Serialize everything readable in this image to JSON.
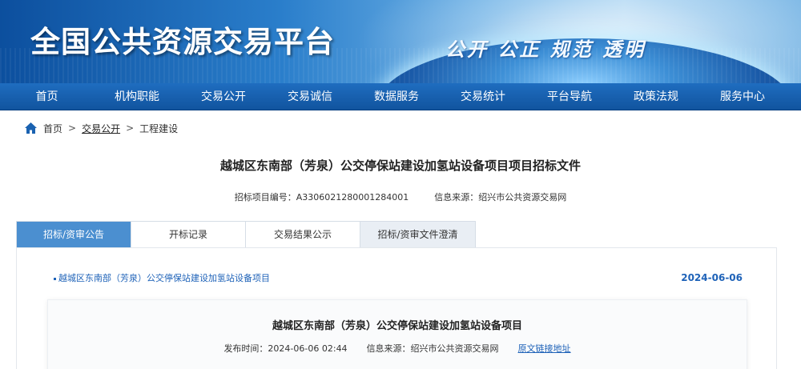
{
  "header": {
    "site_title": "全国公共资源交易平台",
    "slogan": "公开 公正 规范 透明"
  },
  "nav": {
    "items": [
      "首页",
      "机构职能",
      "交易公开",
      "交易诚信",
      "数据服务",
      "交易统计",
      "平台导航",
      "政策法规",
      "服务中心"
    ]
  },
  "breadcrumb": {
    "home": "首页",
    "separator": ">",
    "section": "交易公开",
    "current": "工程建设"
  },
  "page": {
    "title": "越城区东南部（芳泉）公交停保站建设加氢站设备项目项目招标文件",
    "project_no_label": "招标项目编号：A3306021280001284001",
    "source_label": "信息来源：绍兴市公共资源交易网"
  },
  "tabs": [
    {
      "label": "招标/资审公告",
      "active": true
    },
    {
      "label": "开标记录",
      "active": false
    },
    {
      "label": "交易结果公示",
      "active": false
    },
    {
      "label": "招标/资审文件澄清",
      "active": false
    }
  ],
  "content": {
    "item_title": "越城区东南部（芳泉）公交停保站建设加氢站设备项目",
    "item_date": "2024-06-06",
    "doc_title": "越城区东南部（芳泉）公交停保站建设加氢站设备项目",
    "publish_time": "发布时间：2024-06-06 02:44",
    "doc_source": "信息来源：绍兴市公共资源交易网",
    "original_link": "原文链接地址"
  },
  "colors": {
    "nav_blue": "#1a62b1",
    "active_tab": "#4b8fd0",
    "link_blue": "#1e62b8"
  },
  "icons": {
    "home": "home-icon"
  }
}
